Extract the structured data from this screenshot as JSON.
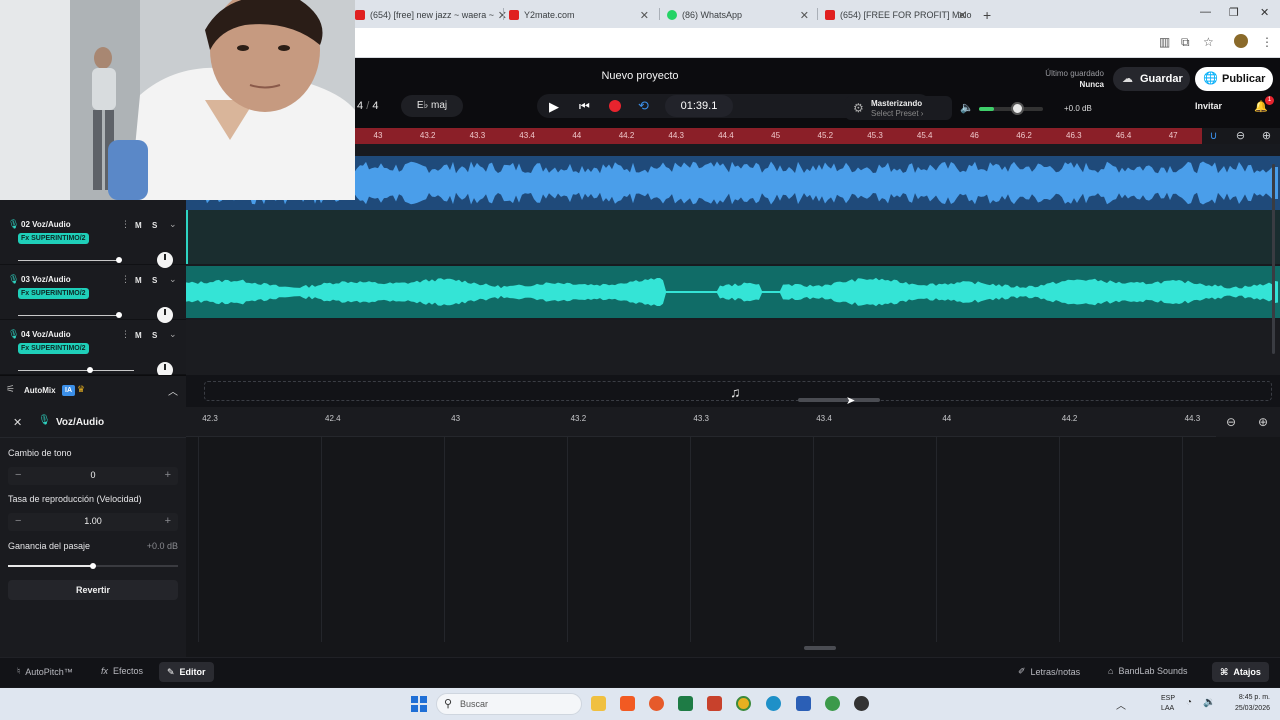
{
  "browser": {
    "tabs": [
      {
        "title": "(654) [free] new jazz ~ waera ~"
      },
      {
        "title": "Y2mate.com"
      },
      {
        "title": "(86) WhatsApp"
      },
      {
        "title": "(654) [FREE FOR PROFIT] Melo"
      }
    ],
    "new_tab_glyph": "+"
  },
  "header": {
    "project_title": "Nuevo proyecto",
    "time_signature_num": "4",
    "time_signature_den": "4",
    "key": "E♭ maj",
    "time_display": "01:39.1",
    "mastering_title": "Masterizando",
    "mastering_sub": "Select Preset ›",
    "volume_db": "+0.0 dB",
    "last_saved_label": "Último guardado",
    "last_saved_value": "Nunca",
    "save_label": "Guardar",
    "publish_label": "Publicar",
    "invite_label": "Invitar",
    "notification_count": "1",
    "volume_level": 0.6
  },
  "ruler": {
    "ticks": [
      "43",
      "43.2",
      "43.3",
      "43.4",
      "44",
      "44.2",
      "44.3",
      "44.4",
      "45",
      "45.2",
      "45.3",
      "45.4",
      "46",
      "46.2",
      "46.3",
      "46.4",
      "47"
    ]
  },
  "tracks": [
    {
      "number": "02",
      "name": "Voz/Audio",
      "fx": "Fx SUPERINTIMO/2",
      "mute": "M",
      "solo": "S",
      "level": 0.55
    },
    {
      "number": "03",
      "name": "Voz/Audio",
      "fx": "Fx SUPERINTIMO/2",
      "mute": "M",
      "solo": "S",
      "level": 0.55
    },
    {
      "number": "04",
      "name": "Voz/Audio",
      "fx": "Fx SUPERINTIMO/2",
      "mute": "M",
      "solo": "S",
      "level": 0.62
    }
  ],
  "automix": {
    "label": "AutoMix",
    "badge": "IA"
  },
  "editor": {
    "title": "Voz/Audio",
    "pitch_label": "Cambio de tono",
    "pitch_value": "0",
    "rate_label": "Tasa de reproducción (Velocidad)",
    "rate_value": "1.00",
    "gain_label": "Ganancia del pasaje",
    "gain_value": "+0.0 dB",
    "gain_level": 0.5,
    "revert_label": "Revertir",
    "ruler_ticks": [
      "42.3",
      "42.4",
      "43",
      "43.2",
      "43.3",
      "43.4",
      "44",
      "44.2",
      "44.3"
    ]
  },
  "footer": {
    "autopitch": "AutoPitch™",
    "effects": "Efectos",
    "editor": "Editor",
    "lyrics": "Letras/notas",
    "sounds": "BandLab Sounds",
    "shortcuts": "Atajos"
  },
  "taskbar": {
    "search_placeholder": "Buscar",
    "lang_top": "ESP",
    "lang_bottom": "LAA",
    "time": "8:45 p. m.",
    "date": "25/03/2026"
  },
  "colors": {
    "accent_red": "#e8242e",
    "ruler_red": "#8b1f28",
    "track_blue": "#3e92e6",
    "track_teal": "#2ee0d2",
    "fx_teal": "#1fcfb9"
  }
}
